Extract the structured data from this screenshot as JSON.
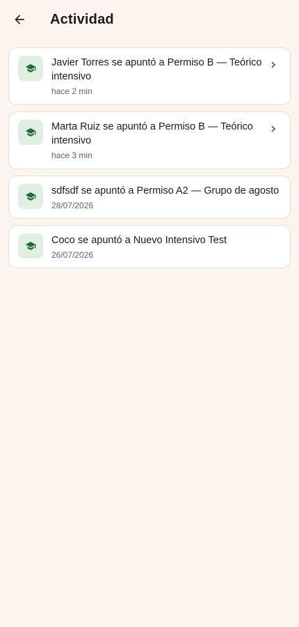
{
  "header": {
    "title": "Actividad",
    "back_icon": "arrow-left-icon"
  },
  "colors": {
    "background": "#fcf4ee",
    "card": "#ffffff",
    "icon_bg": "#dff0e3",
    "icon_fg": "#1f6b3a"
  },
  "activity": {
    "items": [
      {
        "icon": "graduation-cap-icon",
        "text": "Javier Torres se apuntó a Permiso B — Teórico intensivo",
        "time": "hace 2 min",
        "has_chevron": true
      },
      {
        "icon": "graduation-cap-icon",
        "text": "Marta Ruiz se apuntó a Permiso B — Teórico intensivo",
        "time": "hace 3 min",
        "has_chevron": true
      },
      {
        "icon": "graduation-cap-icon",
        "text": "sdfsdf se apuntó a Permiso A2 — Grupo de agosto",
        "time": "28/07/2026",
        "has_chevron": false
      },
      {
        "icon": "graduation-cap-icon",
        "text": "Coco se apuntó a Nuevo Intensivo Test",
        "time": "26/07/2026",
        "has_chevron": false
      }
    ]
  }
}
